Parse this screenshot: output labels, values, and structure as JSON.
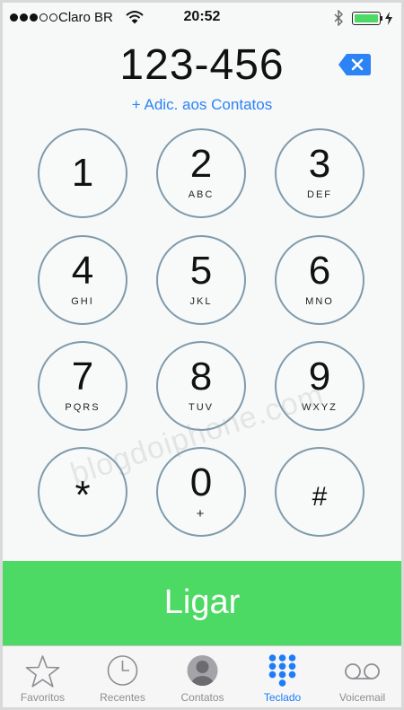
{
  "status_bar": {
    "carrier": "Claro BR",
    "time": "20:52",
    "signal_strength": 3,
    "battery_level": 1.0,
    "battery_color": "#4cd964"
  },
  "dialer": {
    "number": "123-456",
    "add_contact_label": "+ Adic. aos Contatos",
    "backspace_icon": "delete-left-icon"
  },
  "keypad": [
    {
      "digit": "1",
      "letters": ""
    },
    {
      "digit": "2",
      "letters": "ABC"
    },
    {
      "digit": "3",
      "letters": "DEF"
    },
    {
      "digit": "4",
      "letters": "GHI"
    },
    {
      "digit": "5",
      "letters": "JKL"
    },
    {
      "digit": "6",
      "letters": "MNO"
    },
    {
      "digit": "7",
      "letters": "PQRS"
    },
    {
      "digit": "8",
      "letters": "TUV"
    },
    {
      "digit": "9",
      "letters": "WXYZ"
    },
    {
      "digit": "*",
      "letters": ""
    },
    {
      "digit": "0",
      "letters": "+"
    },
    {
      "digit": "#",
      "letters": ""
    }
  ],
  "watermark": "blogdoiphone.com",
  "call_button": {
    "label": "Ligar",
    "color": "#4cd964"
  },
  "tab_bar": {
    "active_color": "#1f7bf6",
    "tabs": [
      {
        "label": "Favoritos",
        "icon": "star-icon",
        "active": false
      },
      {
        "label": "Recentes",
        "icon": "clock-icon",
        "active": false
      },
      {
        "label": "Contatos",
        "icon": "contact-icon",
        "active": false
      },
      {
        "label": "Teclado",
        "icon": "keypad-icon",
        "active": true
      },
      {
        "label": "Voicemail",
        "icon": "voicemail-icon",
        "active": false
      }
    ]
  }
}
